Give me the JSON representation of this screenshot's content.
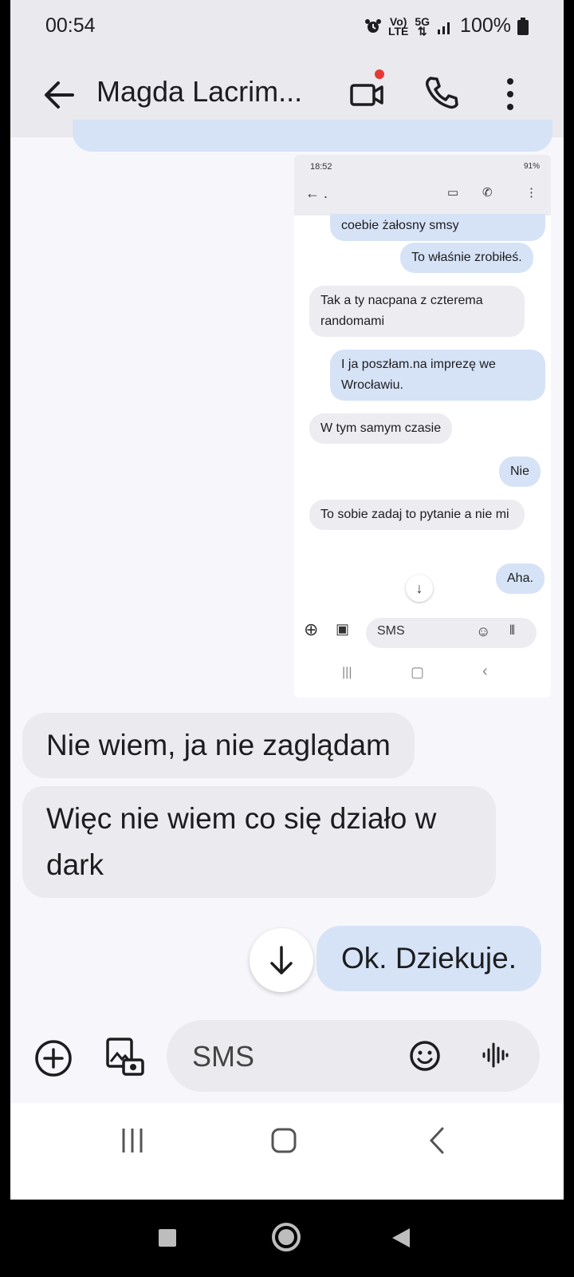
{
  "status_bar": {
    "time": "00:54",
    "battery": "100%"
  },
  "app_bar": {
    "title": "Magda Lacrim..."
  },
  "inner_screenshot": {
    "status_time": "18:52",
    "status_battery": "91%",
    "back_label": ".",
    "messages": [
      {
        "dir": "out",
        "text": "coebie żałosny smsy"
      },
      {
        "dir": "out",
        "text": "To właśnie zrobiłeś."
      },
      {
        "dir": "in",
        "text": "Tak a ty nacpana z czterema randomami"
      },
      {
        "dir": "out",
        "text": "I ja poszłam.na imprezę we Wrocławiu."
      },
      {
        "dir": "in",
        "text": "W tym samym czasie"
      },
      {
        "dir": "out",
        "text": "Nie"
      },
      {
        "dir": "in",
        "text": "To sobie zadaj to pytanie a nie mi"
      },
      {
        "dir": "out",
        "text": "Aha."
      }
    ],
    "compose_placeholder": "SMS"
  },
  "messages": [
    {
      "dir": "in",
      "text": "Nie wiem, ja nie zaglądam"
    },
    {
      "dir": "in",
      "text": "Więc nie wiem co się działo w dark"
    },
    {
      "dir": "out",
      "text": "Ok. Dziekuje."
    }
  ],
  "compose": {
    "placeholder": "SMS"
  },
  "colors": {
    "outgoing_bubble": "#d6e3f7",
    "incoming_bubble": "#ebebef",
    "accent_dot": "#e53935"
  }
}
